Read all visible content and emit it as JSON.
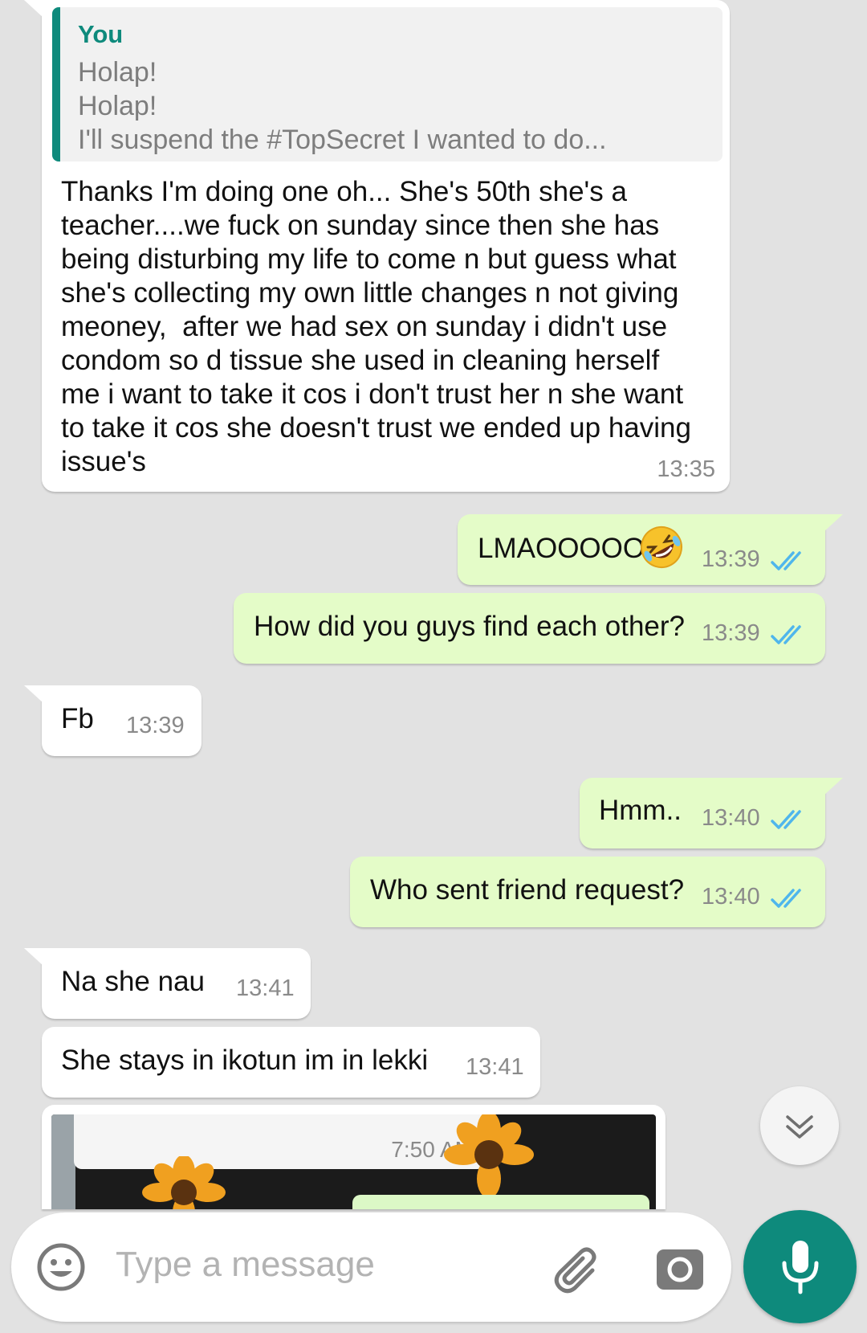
{
  "messages": [
    {
      "quote": {
        "author": "You",
        "lines": [
          "Holap!",
          "Holap!",
          "I'll suspend the #TopSecret I wanted to do..."
        ]
      },
      "text": "Thanks I'm doing one oh... She's 50th she's a\nteacher....we fuck on sunday since then she has\nbeing disturbing my life to come n but guess what\nshe's collecting my own little changes n not giving\nmeoney,  after we had sex on sunday i didn't use\ncondom so d tissue she used in cleaning herself\nme i want to take it cos i don't trust her n she want\nto take it cos she doesn't trust we ended up having\nissue's",
      "time": "13:35"
    },
    {
      "text": "LMAOOOOO",
      "time": "13:39"
    },
    {
      "text": "How did you guys find each other?",
      "time": "13:39"
    },
    {
      "text": "Fb",
      "time": "13:39"
    },
    {
      "text": "Hmm..",
      "time": "13:40"
    },
    {
      "text": "Who sent friend request?",
      "time": "13:40"
    },
    {
      "text": "Na she nau",
      "time": "13:41"
    },
    {
      "text": "She stays in ikotun im in lekki",
      "time": "13:41"
    },
    {
      "image": {
        "inner_time": "7:50 AM"
      }
    }
  ],
  "composer": {
    "placeholder": "Type a message"
  },
  "icons": {
    "emoji": "emoji-icon",
    "attach": "paperclip-icon",
    "camera": "camera-icon",
    "mic": "mic-icon",
    "scroll_down": "chevron-double-down-icon",
    "read_receipt": "double-check-icon",
    "rolling_laughing": "rolling-on-floor-laughing-emoji"
  },
  "colors": {
    "background": "#e2e2e2",
    "incoming": "#ffffff",
    "outgoing": "#e4fcc8",
    "accent": "#0e8a7c",
    "tick": "#4fb6ec"
  }
}
